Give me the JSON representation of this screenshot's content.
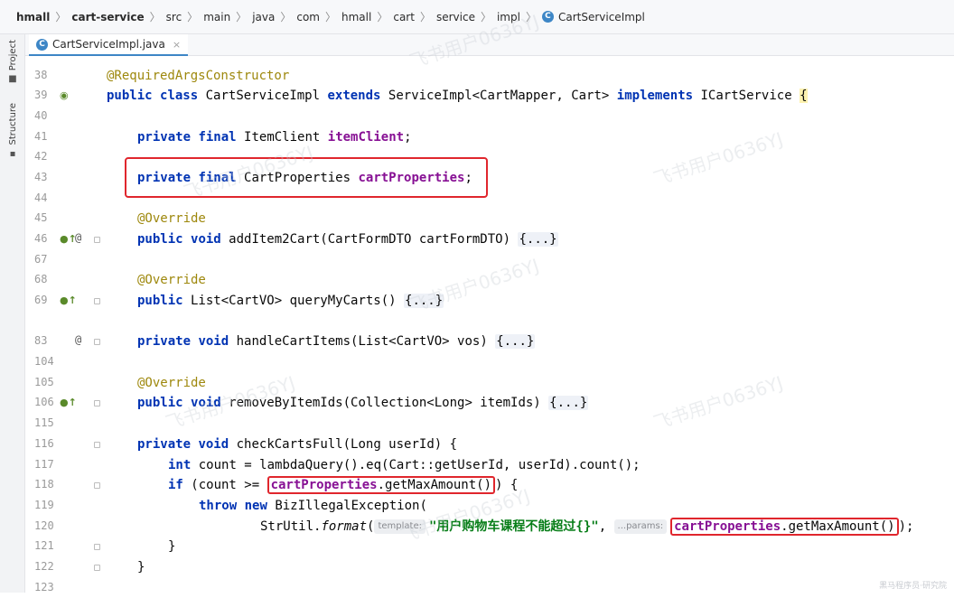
{
  "breadcrumb": {
    "items": [
      "hmall",
      "cart-service",
      "src",
      "main",
      "java",
      "com",
      "hmall",
      "cart",
      "service",
      "impl",
      "CartServiceImpl"
    ],
    "class_icon_letter": "C"
  },
  "tab": {
    "label": "CartServiceImpl.java",
    "close": "×",
    "icon_letter": "C"
  },
  "toolstrip": {
    "project": "Project",
    "structure": "Structure"
  },
  "gutter": {
    "lines": [
      "38",
      "39",
      "40",
      "41",
      "42",
      "43",
      "44",
      "45",
      "46",
      "67",
      "68",
      "69",
      "83",
      "104",
      "105",
      "106",
      "115",
      "116",
      "117",
      "118",
      "119",
      "120",
      "121",
      "122",
      "123"
    ]
  },
  "code": {
    "l38": "@RequiredArgsConstructor",
    "l39": {
      "a": "public",
      "b": " ",
      "c": "class",
      "d": " CartServiceImpl ",
      "e": "extends",
      "f": " ServiceImpl<CartMapper, Cart> ",
      "g": "implements",
      "h": " ICartService ",
      "i": "{"
    },
    "l41": {
      "a": "private",
      "b": " ",
      "c": "final",
      "d": " ItemClient ",
      "e": "itemClient",
      "f": ";"
    },
    "l43": {
      "a": "private",
      "b": " ",
      "c": "final",
      "d": " CartProperties ",
      "e": "cartProperties",
      "f": ";"
    },
    "l45": "@Override",
    "l46": {
      "a": "public",
      "b": " ",
      "c": "void",
      "d": " addItem2Cart(CartFormDTO cartFormDTO) ",
      "e": "{...}"
    },
    "l68": "@Override",
    "l69": {
      "a": "public",
      "b": " List<CartVO> queryMyCarts() ",
      "c": "{...}"
    },
    "l83": {
      "a": "private",
      "b": " ",
      "c": "void",
      "d": " handleCartItems(List<CartVO> vos) ",
      "e": "{...}"
    },
    "l105": "@Override",
    "l106": {
      "a": "public",
      "b": " ",
      "c": "void",
      "d": " removeByItemIds(Collection<Long> itemIds) ",
      "e": "{...}"
    },
    "l116": {
      "a": "private",
      "b": " ",
      "c": "void",
      "d": " checkCartsFull(Long userId) {"
    },
    "l117": {
      "a": "int",
      "b": " count = lambdaQuery().eq(Cart::getUserId, userId).count();"
    },
    "l118": {
      "a": "if",
      "b": " (count >= ",
      "c": "cartProperties",
      "d": ".getMaxAmount()",
      "e": ") {"
    },
    "l119": {
      "a": "throw",
      "b": " ",
      "c": "new",
      "d": " BizIllegalException("
    },
    "l120": {
      "a": "StrUtil.",
      "b": "format",
      "c": "(",
      "hint1": "template:",
      "s": "\"用户购物车课程不能超过{}\"",
      "d": ", ",
      "hint2": "...params:",
      "e": "cartProperties",
      "f": ".getMaxAmount()",
      "g": ");"
    },
    "l121": "}",
    "l122": "}"
  },
  "watermark": "飞书用户0636YJ",
  "footer_watermark": "黑马程序员·研究院"
}
